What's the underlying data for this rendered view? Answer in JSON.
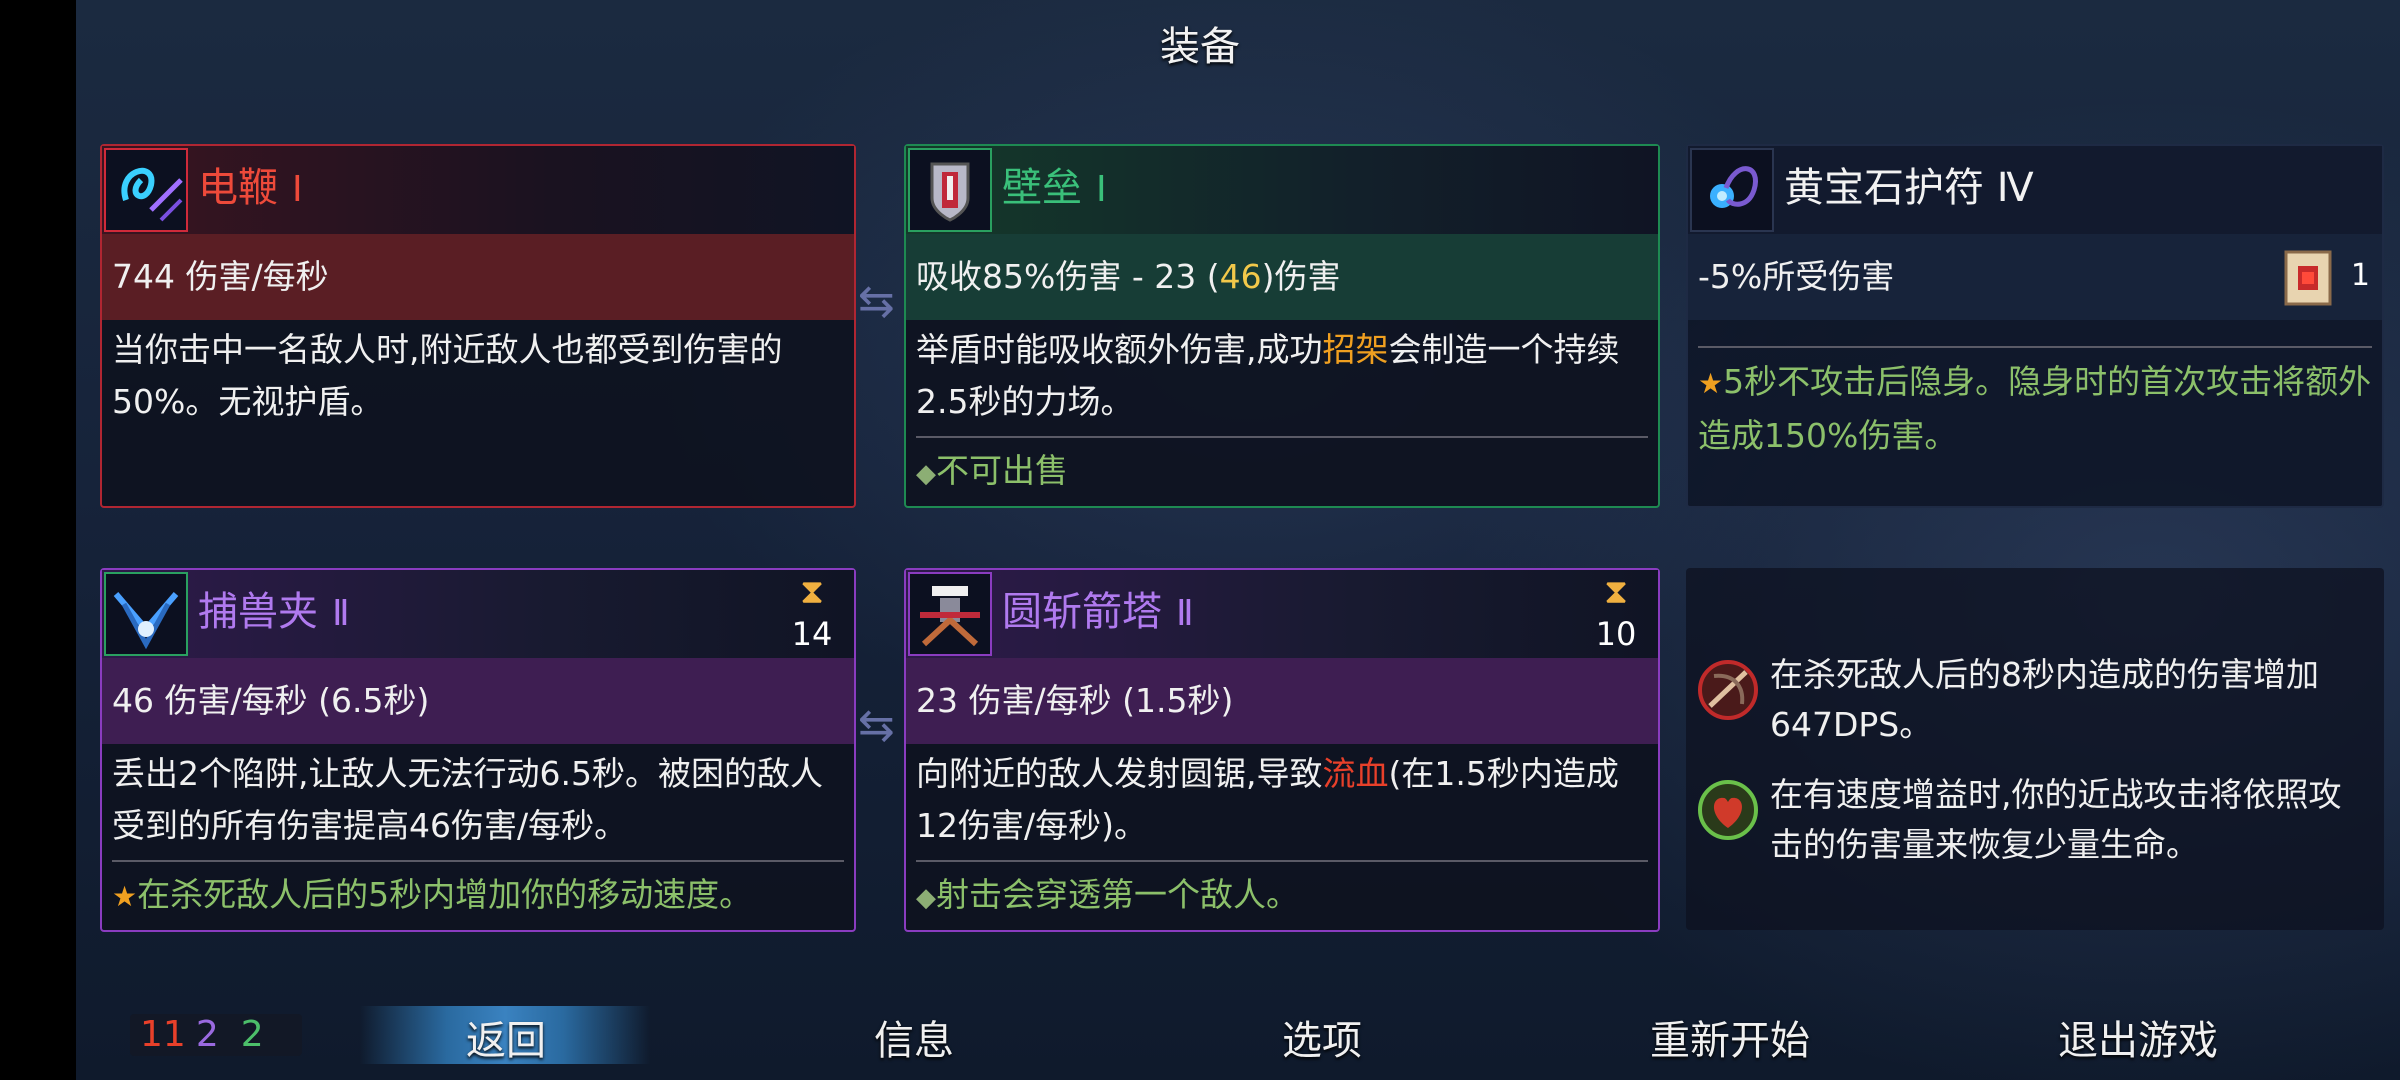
{
  "title": "装备",
  "cards": {
    "whip": {
      "name": "电鞭",
      "level": "Ⅰ",
      "stat": "744 伤害/每秒",
      "desc": "当你击中一名敌人时,附近敌人也都受到伤害的50%。无视护盾。"
    },
    "rampart": {
      "name": "壁垒",
      "level": "Ⅰ",
      "stat_a": "吸收85%伤害 - 23 (",
      "stat_b": "46",
      "stat_c": ")伤害",
      "desc_a": "举盾时能吸收额外伤害,成功",
      "desc_b": "招架",
      "desc_c": "会制造一个持续2.5秒的力场。",
      "foot": "不可出售"
    },
    "amulet": {
      "name": "黄宝石护符 Ⅳ",
      "stat": "-5%所受伤害",
      "scroll_count": "1",
      "foot": "5秒不攻击后隐身。隐身时的首次攻击将额外造成150%伤害。"
    },
    "trap": {
      "name": "捕兽夹",
      "level": "Ⅱ",
      "timer": "14",
      "stat": "46 伤害/每秒 (6.5秒)",
      "desc": "丢出2个陷阱,让敌人无法行动6.5秒。被困的敌人受到的所有伤害提高46伤害/每秒。",
      "foot": "在杀死敌人后的5秒内增加你的移动速度。"
    },
    "turret": {
      "name": "圆斩箭塔",
      "level": "Ⅱ",
      "timer": "10",
      "stat": "23 伤害/每秒 (1.5秒)",
      "desc_a": "向附近的敌人发射圆锯,导致",
      "desc_b": "流血",
      "desc_c": "(在1.5秒内造成12伤害/每秒)。",
      "foot": "射击会穿透第一个敌人。"
    }
  },
  "mutations": [
    {
      "icon": "crossbow-skull-icon",
      "text": "在杀死敌人后的8秒内造成的伤害增加647DPS。"
    },
    {
      "icon": "bleeding-heart-icon",
      "text": "在有速度增益时,你的近战攻击将依照攻击的伤害量来恢复少量生命。"
    }
  ],
  "scrolls": {
    "brutality": "11",
    "tactics": "2",
    "survival": "2"
  },
  "menu": {
    "back": "返回",
    "info": "信息",
    "options": "选项",
    "restart": "重新开始",
    "quit": "退出游戏"
  },
  "colors": {
    "brutality": "#e8402a",
    "tactics": "#9a6ae0",
    "survival": "#4cbf6a",
    "accent_back": "#3a82c0"
  }
}
